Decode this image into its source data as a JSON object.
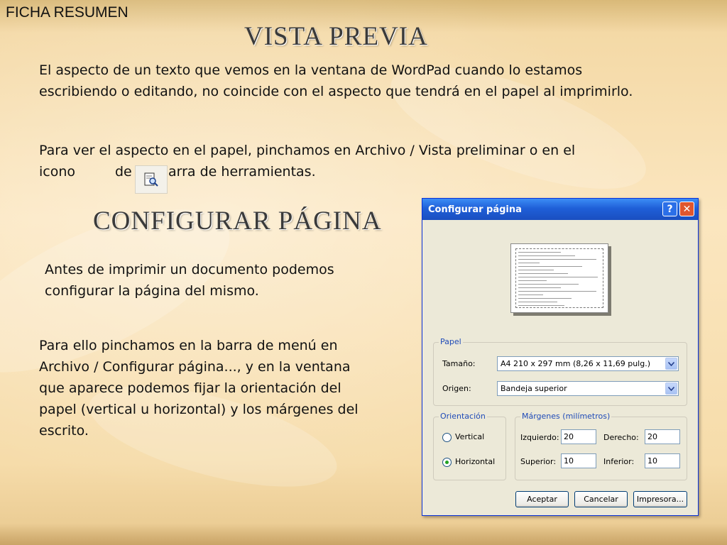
{
  "header": {
    "label": "FICHA RESUMEN"
  },
  "section1": {
    "title": "VISTA PREVIA",
    "paragraph1_line1": "El aspecto de un texto que vemos en la ventana de WordPad cuando lo estamos",
    "paragraph1_line2": "escribiendo o editando, no coincide con el aspecto que tendrá en el papel al imprimirlo.",
    "paragraph2_line1": "Para ver el aspecto en el papel, pinchamos en Archivo / Vista preliminar o en el",
    "paragraph2_line2_a": "icono",
    "paragraph2_line2_b": "de",
    "paragraph2_line2_c": "arra de herramientas.",
    "icon": "print-preview-icon"
  },
  "section2": {
    "title": "CONFIGURAR PÁGINA",
    "paragraph1_line1": "Antes de imprimir un documento podemos",
    "paragraph1_line2": "configurar la página del mismo.",
    "paragraph2_lines": [
      "Para ello pinchamos en la barra de menú en",
      "Archivo / Configurar página..., y en la ventana",
      "que aparece podemos fijar la orientación del",
      "papel (vertical u horizontal) y los márgenes del",
      "escrito."
    ]
  },
  "dialog": {
    "title": "Configurar página",
    "help_label": "?",
    "close_label": "✕",
    "paper_group": {
      "label": "Papel",
      "size_label": "Tamaño:",
      "size_value": "A4 210 x 297 mm (8,26 x 11,69 pulg.)",
      "source_label": "Origen:",
      "source_value": "Bandeja superior"
    },
    "orientation_group": {
      "label": "Orientación",
      "vertical_label": "Vertical",
      "horizontal_label": "Horizontal",
      "selected": "Horizontal"
    },
    "margins_group": {
      "label": "Márgenes (milímetros)",
      "left_label": "Izquierdo:",
      "left_value": "20",
      "right_label": "Derecho:",
      "right_value": "20",
      "top_label": "Superior:",
      "top_value": "10",
      "bottom_label": "Inferior:",
      "bottom_value": "10"
    },
    "buttons": {
      "ok": "Aceptar",
      "cancel": "Cancelar",
      "printer": "Impresora..."
    }
  },
  "colors": {
    "titlebar": "#1f5fd8",
    "dialog_bg": "#ece9d8",
    "group_label": "#1f4bb8",
    "slide_bg": "#fbe6bf"
  }
}
